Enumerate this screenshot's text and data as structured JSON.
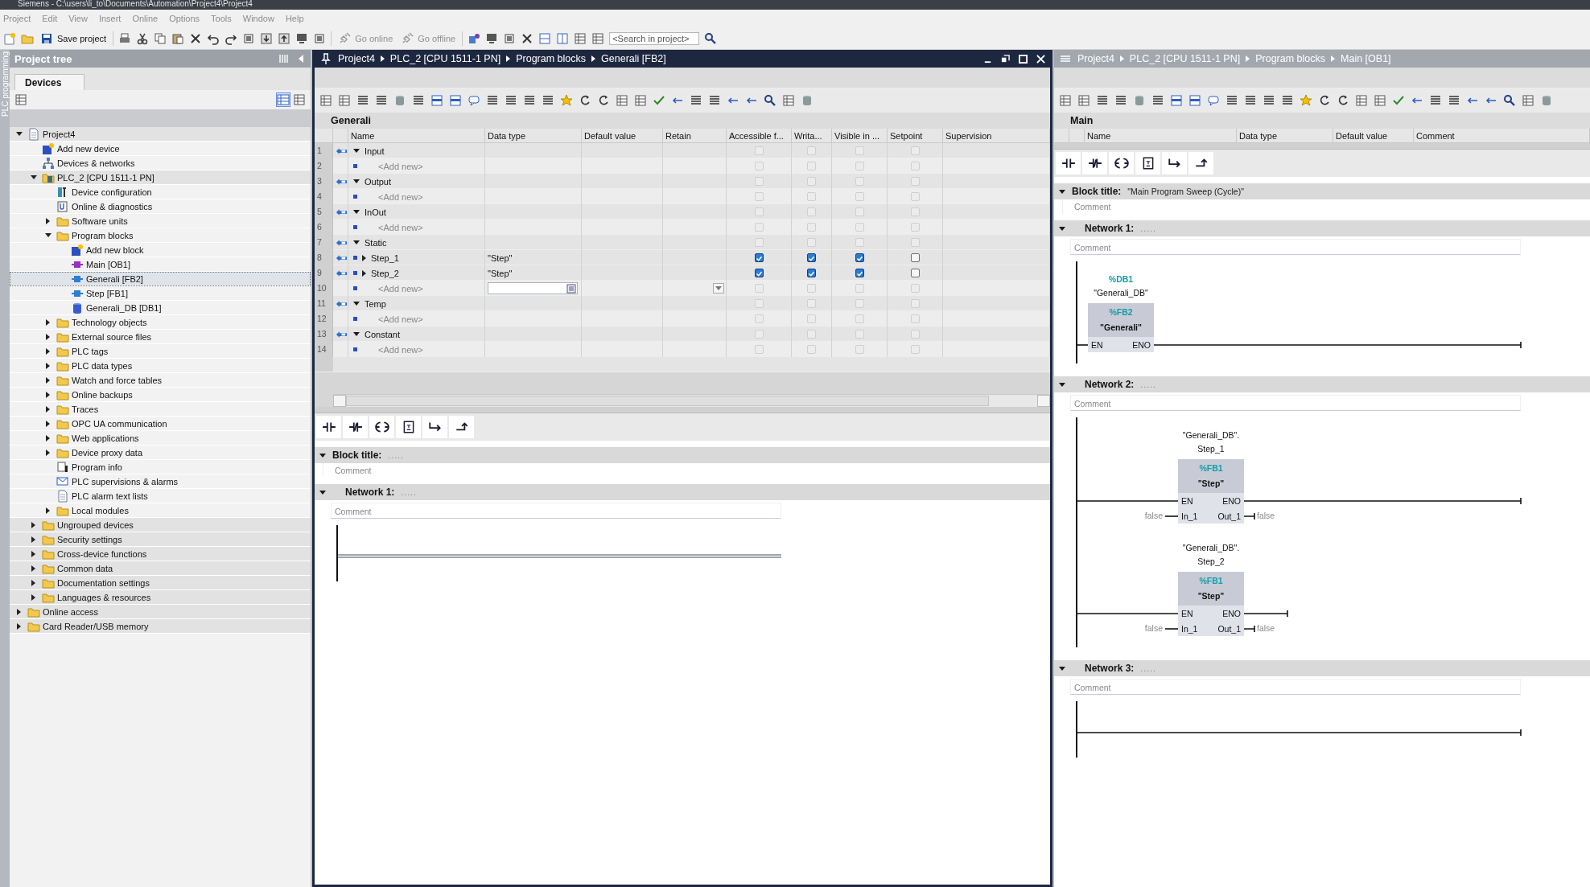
{
  "window": {
    "title": "Siemens  -  C:\\users\\li_to\\Documents\\Automation\\Project4\\Project4"
  },
  "menu": [
    "Project",
    "Edit",
    "View",
    "Insert",
    "Online",
    "Options",
    "Tools",
    "Window",
    "Help"
  ],
  "toolbar": {
    "save": "Save project",
    "go_online": {
      "label": "Go online",
      "disabled": true
    },
    "go_offline": {
      "label": "Go offline",
      "disabled": true
    },
    "search": {
      "placeholder": "<Search in project>"
    }
  },
  "project_tree": {
    "side_label": "PLC programming",
    "title": "Project tree",
    "tabs": [
      {
        "label": "Devices",
        "selected": true
      }
    ],
    "items": [
      {
        "label": "Project4",
        "kind": "project",
        "expanded": true,
        "selected": false,
        "children": [
          {
            "label": "Add new device",
            "kind": "add",
            "selected": false
          },
          {
            "label": "Devices & networks",
            "kind": "network",
            "selected": false
          },
          {
            "label": "PLC_2 [CPU 1511-1 PN]",
            "kind": "plc",
            "expanded": true,
            "selected": false,
            "children": [
              {
                "label": "Device configuration",
                "kind": "config",
                "selected": false
              },
              {
                "label": "Online & diagnostics",
                "kind": "diag",
                "selected": false
              },
              {
                "label": "Software units",
                "kind": "folder",
                "expanded": false,
                "selected": false
              },
              {
                "label": "Program blocks",
                "kind": "folder",
                "expanded": true,
                "selected": false,
                "children": [
                  {
                    "label": "Add new block",
                    "kind": "add",
                    "selected": false
                  },
                  {
                    "label": "Main [OB1]",
                    "kind": "ob",
                    "selected": false
                  },
                  {
                    "label": "Generali [FB2]",
                    "kind": "fb",
                    "selected": true
                  },
                  {
                    "label": "Step [FB1]",
                    "kind": "fb",
                    "selected": false
                  },
                  {
                    "label": "Generali_DB [DB1]",
                    "kind": "db",
                    "selected": false
                  }
                ]
              },
              {
                "label": "Technology objects",
                "kind": "folder",
                "expanded": false,
                "selected": false
              },
              {
                "label": "External source files",
                "kind": "folder",
                "expanded": false,
                "selected": false
              },
              {
                "label": "PLC tags",
                "kind": "folder",
                "expanded": false,
                "selected": false
              },
              {
                "label": "PLC data types",
                "kind": "folder",
                "expanded": false,
                "selected": false
              },
              {
                "label": "Watch and force tables",
                "kind": "folder",
                "expanded": false,
                "selected": false
              },
              {
                "label": "Online backups",
                "kind": "folder",
                "expanded": false,
                "selected": false
              },
              {
                "label": "Traces",
                "kind": "folder",
                "expanded": false,
                "selected": false
              },
              {
                "label": "OPC UA communication",
                "kind": "folder",
                "expanded": false,
                "selected": false
              },
              {
                "label": "Web applications",
                "kind": "folder",
                "expanded": false,
                "selected": false
              },
              {
                "label": "Device proxy data",
                "kind": "folder",
                "expanded": false,
                "selected": false
              },
              {
                "label": "Program info",
                "kind": "info",
                "selected": false
              },
              {
                "label": "PLC supervisions & alarms",
                "kind": "alarm",
                "selected": false
              },
              {
                "label": "PLC alarm text lists",
                "kind": "list",
                "selected": false
              },
              {
                "label": "Local modules",
                "kind": "folder",
                "expanded": false,
                "selected": false
              }
            ]
          },
          {
            "label": "Ungrouped devices",
            "kind": "folder",
            "expanded": false,
            "selected": false
          },
          {
            "label": "Security settings",
            "kind": "folder",
            "expanded": false,
            "selected": false
          },
          {
            "label": "Cross-device functions",
            "kind": "folder",
            "expanded": false,
            "selected": false
          },
          {
            "label": "Common data",
            "kind": "folder",
            "expanded": false,
            "selected": false
          },
          {
            "label": "Documentation settings",
            "kind": "folder",
            "expanded": false,
            "selected": false
          },
          {
            "label": "Languages & resources",
            "kind": "folder",
            "expanded": false,
            "selected": false
          }
        ]
      },
      {
        "label": "Online access",
        "kind": "folder",
        "expanded": false,
        "selected": false
      },
      {
        "label": "Card Reader/USB memory",
        "kind": "folder",
        "expanded": false,
        "selected": false
      }
    ]
  },
  "editors": [
    {
      "active": true,
      "breadcrumb": [
        "Project4",
        "PLC_2 [CPU 1511-1 PN]",
        "Program blocks",
        "Generali [FB2]"
      ],
      "block_name": "Generali",
      "interface": {
        "columns": [
          "Name",
          "Data type",
          "Default value",
          "Retain",
          "Accessible f...",
          "Writa...",
          "Visible in ...",
          "Setpoint",
          "Supervision"
        ],
        "rows": [
          {
            "num": "1",
            "kind": "section",
            "name": "Input",
            "expanded": true,
            "editing": false,
            "enabled": false,
            "checks": [
              false,
              false,
              false,
              false
            ]
          },
          {
            "num": "2",
            "kind": "add",
            "name": "<Add new>",
            "editing": false,
            "enabled": false,
            "checks": [
              false,
              false,
              false,
              false
            ]
          },
          {
            "num": "3",
            "kind": "section",
            "name": "Output",
            "expanded": true,
            "editing": false,
            "enabled": false,
            "checks": [
              false,
              false,
              false,
              false
            ]
          },
          {
            "num": "4",
            "kind": "add",
            "name": "<Add new>",
            "editing": false,
            "enabled": false,
            "checks": [
              false,
              false,
              false,
              false
            ]
          },
          {
            "num": "5",
            "kind": "section",
            "name": "InOut",
            "expanded": true,
            "editing": false,
            "enabled": false,
            "checks": [
              false,
              false,
              false,
              false
            ]
          },
          {
            "num": "6",
            "kind": "add",
            "name": "<Add new>",
            "editing": false,
            "enabled": false,
            "checks": [
              false,
              false,
              false,
              false
            ]
          },
          {
            "num": "7",
            "kind": "section",
            "name": "Static",
            "expanded": true,
            "editing": false,
            "enabled": false,
            "checks": [
              false,
              false,
              false,
              false
            ]
          },
          {
            "num": "8",
            "kind": "var",
            "name": "Step_1",
            "data_type": "\"Step\"",
            "expanded": false,
            "editing": false,
            "enabled": true,
            "checks": [
              true,
              true,
              true,
              false
            ]
          },
          {
            "num": "9",
            "kind": "var",
            "name": "Step_2",
            "data_type": "\"Step\"",
            "expanded": false,
            "editing": false,
            "enabled": true,
            "checks": [
              true,
              true,
              true,
              false
            ]
          },
          {
            "num": "10",
            "kind": "add",
            "name": "<Add new>",
            "editing": true,
            "enabled": false,
            "checks": [
              false,
              false,
              false,
              false
            ]
          },
          {
            "num": "11",
            "kind": "section",
            "name": "Temp",
            "expanded": true,
            "editing": false,
            "enabled": false,
            "checks": [
              false,
              false,
              false,
              false
            ]
          },
          {
            "num": "12",
            "kind": "add",
            "name": "<Add new>",
            "editing": false,
            "enabled": false,
            "checks": [
              false,
              false,
              false,
              false
            ]
          },
          {
            "num": "13",
            "kind": "section",
            "name": "Constant",
            "expanded": true,
            "editing": false,
            "enabled": false,
            "checks": [
              false,
              false,
              false,
              false
            ]
          },
          {
            "num": "14",
            "kind": "add",
            "name": "<Add new>",
            "editing": false,
            "enabled": false,
            "checks": [
              false,
              false,
              false,
              false
            ]
          }
        ]
      },
      "block_title": {
        "label": "Block title:",
        "value": ".....",
        "comment": "Comment"
      },
      "networks": [
        {
          "title": "Network 1:",
          "dots": ".....",
          "comment": "Comment",
          "selected": true
        }
      ]
    },
    {
      "active": false,
      "breadcrumb": [
        "Project4",
        "PLC_2 [CPU 1511-1 PN]",
        "Program blocks",
        "Main [OB1]"
      ],
      "block_name": "Main",
      "interface": {
        "columns": [
          "Name",
          "Data type",
          "Default value",
          "Comment"
        ]
      },
      "block_title": {
        "label": "Block title:",
        "value": "\"Main Program Sweep (Cycle)\"",
        "comment": "Comment"
      },
      "networks": [
        {
          "title": "Network 1:",
          "dots": ".....",
          "comment": "Comment",
          "calls": [
            {
              "db": "%DB1",
              "instance": [
                "\"Generali_DB\""
              ],
              "number": "%FB2",
              "name": "\"Generali\"",
              "pins": [
                {
                  "in": "EN",
                  "out": "ENO"
                }
              ]
            }
          ]
        },
        {
          "title": "Network 2:",
          "dots": ".....",
          "comment": "Comment",
          "calls": [
            {
              "instance": [
                "\"Generali_DB\".",
                "Step_1"
              ],
              "number": "%FB1",
              "name": "\"Step\"",
              "pins": [
                {
                  "in": "EN",
                  "out": "ENO"
                },
                {
                  "in": "In_1",
                  "out": "Out_1",
                  "in_value": "false",
                  "out_value": "false"
                }
              ]
            },
            {
              "instance": [
                "\"Generali_DB\".",
                "Step_2"
              ],
              "number": "%FB1",
              "name": "\"Step\"",
              "pins": [
                {
                  "in": "EN",
                  "out": "ENO"
                },
                {
                  "in": "In_1",
                  "out": "Out_1",
                  "in_value": "false",
                  "out_value": "false"
                }
              ]
            }
          ]
        },
        {
          "title": "Network 3:",
          "dots": ".....",
          "comment": "Comment",
          "selected": false
        }
      ]
    }
  ]
}
